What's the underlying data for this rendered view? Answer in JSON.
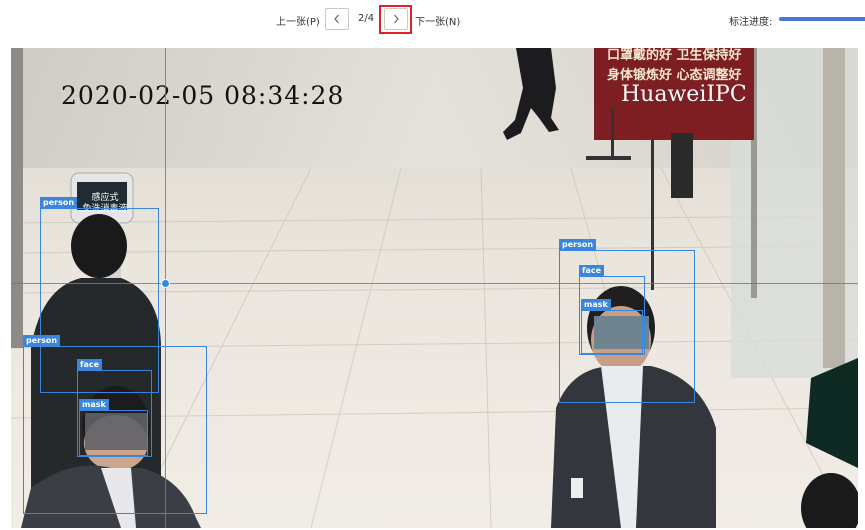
{
  "toolbar": {
    "prev_label": "上一张(P)",
    "page_indicator": "2/4",
    "next_label": "下一张(N)",
    "progress_label": "标注进度:",
    "prev_icon": "chevron-left-icon",
    "next_icon": "chevron-right-icon",
    "accent_color": "#4a78d4",
    "highlight_color": "#e0202a"
  },
  "image": {
    "timestamp": "2020-02-05 08:34:28",
    "camera_brand": "HuaweiIPC",
    "banner_lines": [
      "口罩戴的好 卫生保持好",
      "身体锻炼好 心态调整好"
    ],
    "sign_lines": [
      "感应式",
      "免洗消毒液"
    ]
  },
  "annotations": {
    "box_color": "#3a86dc",
    "boxes": [
      {
        "label": "person"
      },
      {
        "label": "person"
      },
      {
        "label": "face"
      },
      {
        "label": "mask"
      },
      {
        "label": "person"
      },
      {
        "label": "face"
      },
      {
        "label": "mask"
      }
    ]
  }
}
